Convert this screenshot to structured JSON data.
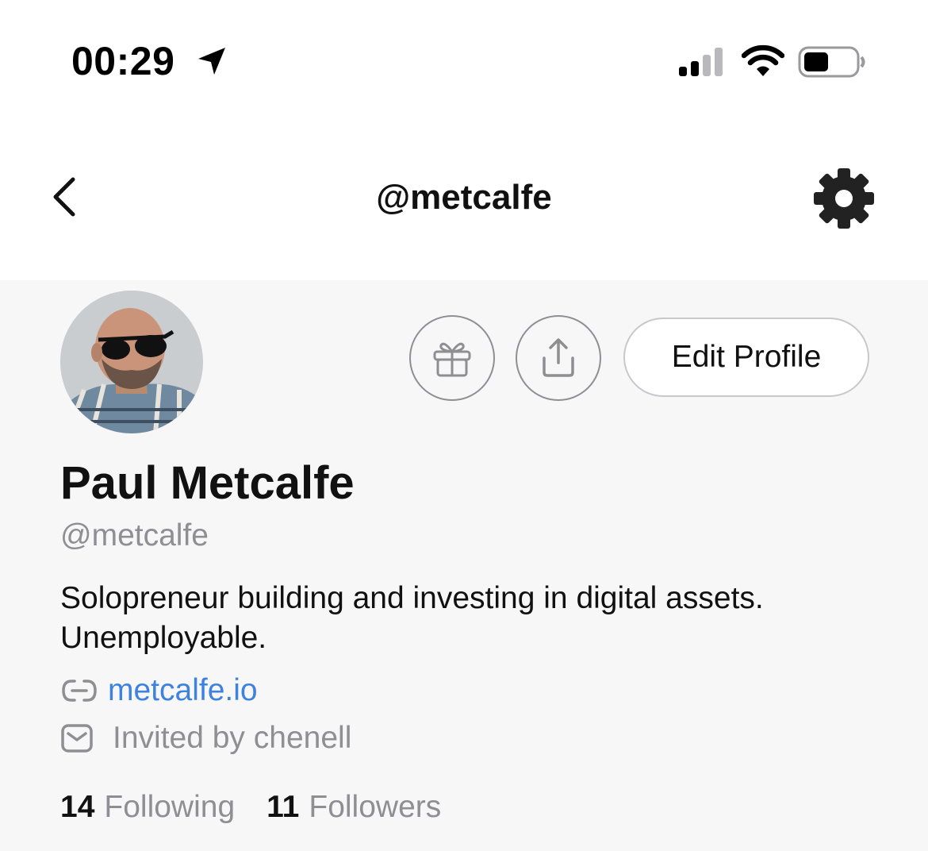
{
  "status_bar": {
    "time": "00:29",
    "icons": [
      "location-arrow-icon",
      "cellular-signal-icon",
      "wifi-icon",
      "battery-icon"
    ]
  },
  "nav": {
    "title": "@metcalfe",
    "back_icon": "chevron-left-icon",
    "settings_icon": "gear-icon"
  },
  "profile": {
    "display_name": "Paul Metcalfe",
    "handle": "@metcalfe",
    "bio": "Solopreneur building and investing in digital assets. Unemployable.",
    "link": "metcalfe.io",
    "invited_by": "Invited by chenell",
    "following_count": "14",
    "following_label": "Following",
    "followers_count": "11",
    "followers_label": "Followers"
  },
  "actions": {
    "gift_icon": "gift-icon",
    "share_icon": "share-icon",
    "edit_label": "Edit Profile"
  },
  "colors": {
    "link": "#3e82e0",
    "secondary_text": "#8e8e93",
    "profile_background": "#f8f7f8"
  }
}
